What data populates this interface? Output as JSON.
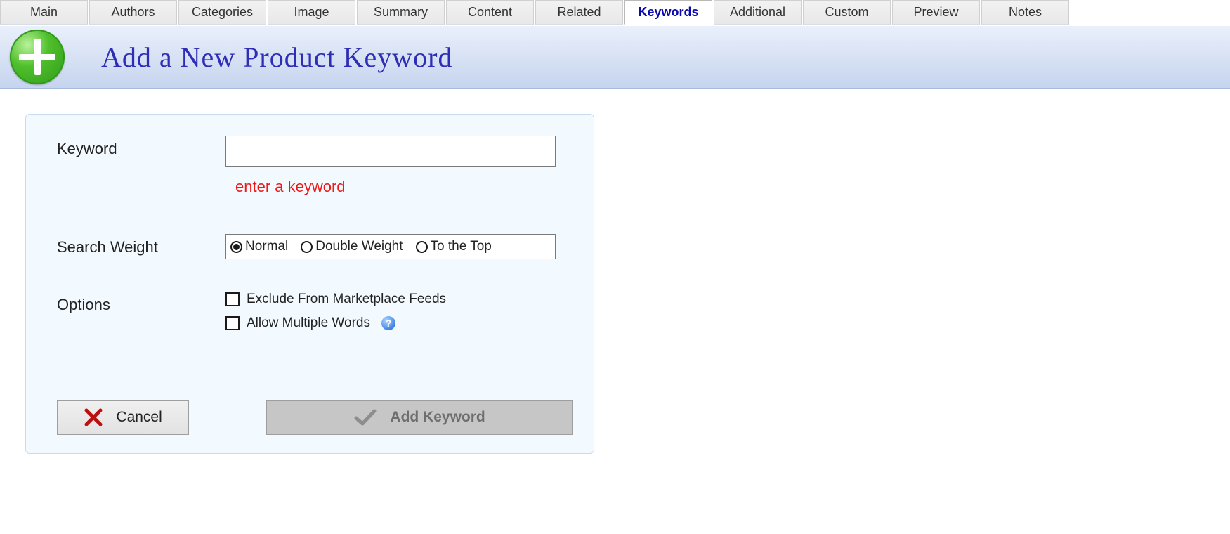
{
  "tabs": [
    "Main",
    "Authors",
    "Categories",
    "Image",
    "Summary",
    "Content",
    "Related",
    "Keywords",
    "Additional",
    "Custom",
    "Preview",
    "Notes"
  ],
  "active_tab": "Keywords",
  "header": {
    "title": "Add a New Product Keyword"
  },
  "form": {
    "keyword_label": "Keyword",
    "keyword_value": "",
    "keyword_validation": "enter a keyword",
    "search_weight_label": "Search Weight",
    "weights": {
      "normal": "Normal",
      "double": "Double Weight",
      "top": "To the Top",
      "selected": "normal"
    },
    "options_label": "Options",
    "option_exclude": "Exclude From Marketplace Feeds",
    "option_multi": "Allow Multiple Words"
  },
  "buttons": {
    "cancel": "Cancel",
    "add": "Add Keyword"
  }
}
